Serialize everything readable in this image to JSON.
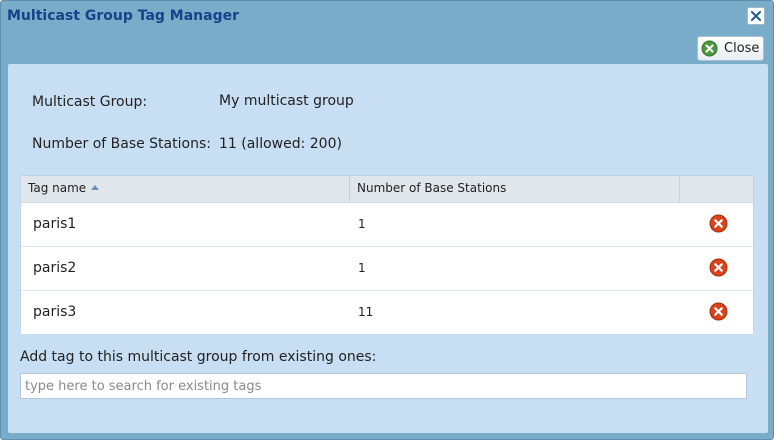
{
  "window": {
    "title": "Multicast Group Tag Manager",
    "close_label": "Close"
  },
  "fields": {
    "group_label": "Multicast Group:",
    "group_value": "My multicast group",
    "stations_label": "Number of Base Stations:",
    "stations_value": "11 (allowed: 200)"
  },
  "table": {
    "columns": [
      "Tag name",
      "Number of Base Stations",
      ""
    ],
    "sort_column": "Tag name",
    "sort_direction": "ascending",
    "rows": [
      {
        "name": "paris1",
        "count": "1"
      },
      {
        "name": "paris2",
        "count": "1"
      },
      {
        "name": "paris3",
        "count": "11"
      }
    ]
  },
  "add_tag": {
    "label": "Add tag to this multicast group from existing ones:",
    "value": "",
    "placeholder": "type here to search for existing tags"
  },
  "colors": {
    "title_text": "#15428b",
    "window_frame": "#78acc8",
    "panel_background": "#c8def3",
    "delete_icon": "#d9441c",
    "close_icon": "#4a9a3f"
  },
  "icons": {
    "title_close": "close-x-icon",
    "toolbar_close": "green-close-circle-icon",
    "row_delete": "red-delete-circle-icon",
    "sort": "sort-ascending-icon"
  }
}
